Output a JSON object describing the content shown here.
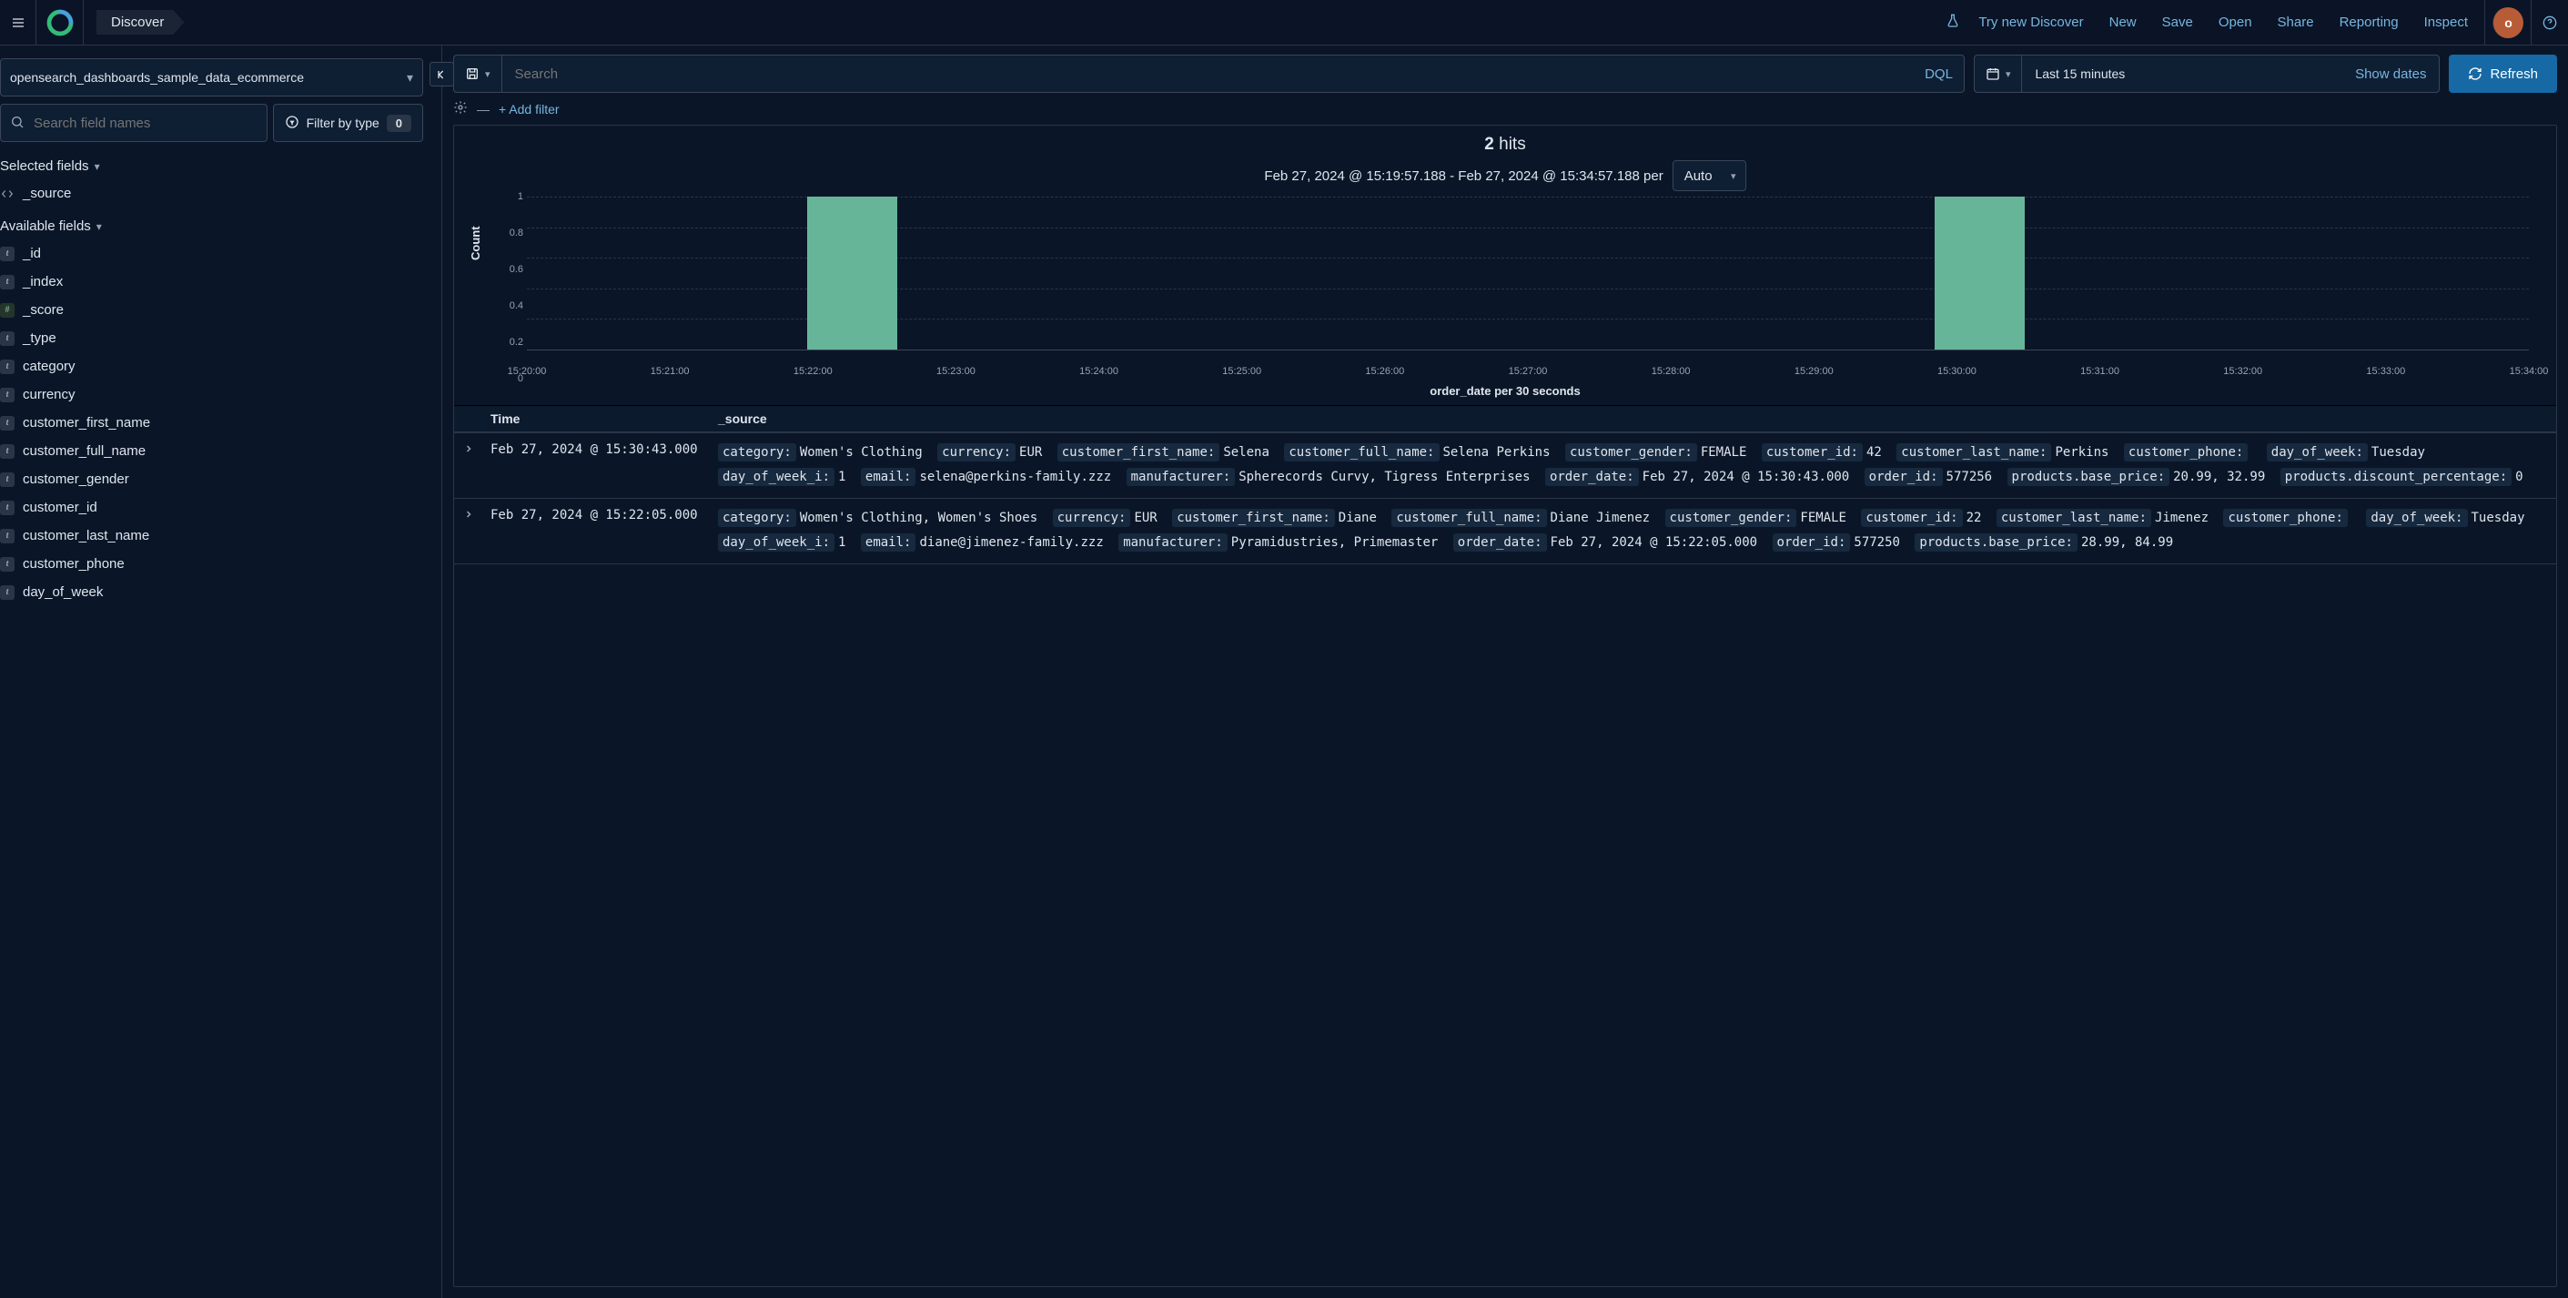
{
  "topbar": {
    "breadcrumb": "Discover",
    "menu": {
      "try_new": "Try new Discover",
      "new": "New",
      "save": "Save",
      "open": "Open",
      "share": "Share",
      "reporting": "Reporting",
      "inspect": "Inspect"
    },
    "avatar_initial": "o"
  },
  "sidebar": {
    "index_pattern": "opensearch_dashboards_sample_data_ecommerce",
    "search_fields_placeholder": "Search field names",
    "filter_by_type_label": "Filter by type",
    "filter_by_type_count": "0",
    "selected_fields_label": "Selected fields",
    "available_fields_label": "Available fields",
    "selected_fields": [
      {
        "icon": "src",
        "name": "_source"
      }
    ],
    "available_fields": [
      {
        "icon": "t",
        "name": "_id"
      },
      {
        "icon": "t",
        "name": "_index"
      },
      {
        "icon": "num",
        "name": "_score"
      },
      {
        "icon": "t",
        "name": "_type"
      },
      {
        "icon": "t",
        "name": "category"
      },
      {
        "icon": "t",
        "name": "currency"
      },
      {
        "icon": "t",
        "name": "customer_first_name"
      },
      {
        "icon": "t",
        "name": "customer_full_name"
      },
      {
        "icon": "t",
        "name": "customer_gender"
      },
      {
        "icon": "t",
        "name": "customer_id"
      },
      {
        "icon": "t",
        "name": "customer_last_name"
      },
      {
        "icon": "t",
        "name": "customer_phone"
      },
      {
        "icon": "t",
        "name": "day_of_week"
      }
    ]
  },
  "query": {
    "search_placeholder": "Search",
    "dql_label": "DQL",
    "time_range": "Last 15 minutes",
    "show_dates": "Show dates",
    "refresh": "Refresh",
    "add_filter": "+ Add filter"
  },
  "results": {
    "hits_count": "2",
    "hits_label": "hits",
    "time_range_caption": "Feb 27, 2024 @ 15:19:57.188 - Feb 27, 2024 @ 15:34:57.188 per",
    "interval": "Auto",
    "chart_ylabel": "Count",
    "chart_xlabel": "order_date per 30 seconds",
    "columns": {
      "time": "Time",
      "source": "_source"
    }
  },
  "chart_data": {
    "type": "bar",
    "ylabel": "Count",
    "xlabel": "order_date per 30 seconds",
    "ylim": [
      0,
      1
    ],
    "yticks": [
      "0",
      "0.2",
      "0.4",
      "0.6",
      "0.8",
      "1"
    ],
    "xticks": [
      "15:20:00",
      "15:21:00",
      "15:22:00",
      "15:23:00",
      "15:24:00",
      "15:25:00",
      "15:26:00",
      "15:27:00",
      "15:28:00",
      "15:29:00",
      "15:30:00",
      "15:31:00",
      "15:32:00",
      "15:33:00",
      "15:34:00"
    ],
    "bars": [
      {
        "x_pct": 14.0,
        "value": 1
      },
      {
        "x_pct": 70.3,
        "value": 1
      }
    ]
  },
  "docs": [
    {
      "time": "Feb 27, 2024 @ 15:30:43.000",
      "fields": [
        {
          "k": "category:",
          "v": "Women's Clothing"
        },
        {
          "k": "currency:",
          "v": "EUR"
        },
        {
          "k": "customer_first_name:",
          "v": "Selena"
        },
        {
          "k": "customer_full_name:",
          "v": "Selena Perkins"
        },
        {
          "k": "customer_gender:",
          "v": "FEMALE"
        },
        {
          "k": "customer_id:",
          "v": "42"
        },
        {
          "k": "customer_last_name:",
          "v": "Perkins"
        },
        {
          "k": "customer_phone:",
          "v": ""
        },
        {
          "k": "day_of_week:",
          "v": "Tuesday"
        },
        {
          "k": "day_of_week_i:",
          "v": "1"
        },
        {
          "k": "email:",
          "v": "selena@perkins-family.zzz"
        },
        {
          "k": "manufacturer:",
          "v": "Spherecords Curvy, Tigress Enterprises"
        },
        {
          "k": "order_date:",
          "v": "Feb 27, 2024 @ 15:30:43.000"
        },
        {
          "k": "order_id:",
          "v": "577256"
        },
        {
          "k": "products.base_price:",
          "v": "20.99, 32.99"
        },
        {
          "k": "products.discount_percentage:",
          "v": "0"
        }
      ]
    },
    {
      "time": "Feb 27, 2024 @ 15:22:05.000",
      "fields": [
        {
          "k": "category:",
          "v": "Women's Clothing, Women's Shoes"
        },
        {
          "k": "currency:",
          "v": "EUR"
        },
        {
          "k": "customer_first_name:",
          "v": "Diane"
        },
        {
          "k": "customer_full_name:",
          "v": "Diane Jimenez"
        },
        {
          "k": "customer_gender:",
          "v": "FEMALE"
        },
        {
          "k": "customer_id:",
          "v": "22"
        },
        {
          "k": "customer_last_name:",
          "v": "Jimenez"
        },
        {
          "k": "customer_phone:",
          "v": ""
        },
        {
          "k": "day_of_week:",
          "v": "Tuesday"
        },
        {
          "k": "day_of_week_i:",
          "v": "1"
        },
        {
          "k": "email:",
          "v": "diane@jimenez-family.zzz"
        },
        {
          "k": "manufacturer:",
          "v": "Pyramidustries, Primemaster"
        },
        {
          "k": "order_date:",
          "v": "Feb 27, 2024 @ 15:22:05.000"
        },
        {
          "k": "order_id:",
          "v": "577250"
        },
        {
          "k": "products.base_price:",
          "v": "28.99, 84.99"
        }
      ]
    }
  ]
}
